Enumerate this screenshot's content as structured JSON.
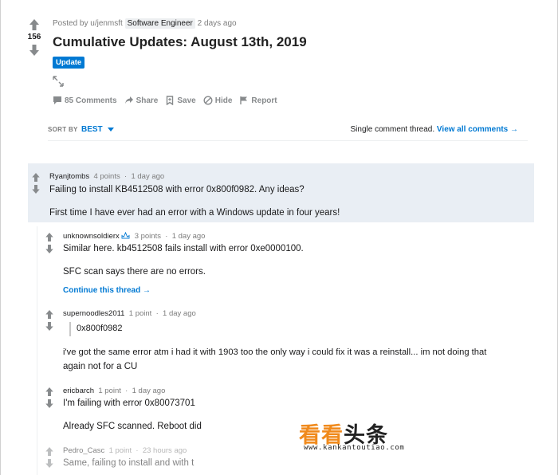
{
  "post": {
    "score": "156",
    "posted_by": "Posted by u/jenmsft",
    "flair": "Software Engineer",
    "age": "2 days ago",
    "title": "Cumulative Updates: August 13th, 2019",
    "tag": "Update",
    "actions": {
      "comments": "85 Comments",
      "share": "Share",
      "save": "Save",
      "hide": "Hide",
      "report": "Report"
    }
  },
  "sort": {
    "label": "SORT BY",
    "value": "BEST",
    "single_thread": "Single comment thread.",
    "view_all": "View all comments →"
  },
  "comments": [
    {
      "author": "Ryanjtombs",
      "points": "4 points",
      "sep": "·",
      "age": "1 day ago",
      "line1": "Failing to install KB4512508 with error 0x800f0982. Any ideas?",
      "line2": "First time I have ever had an error with a Windows update in four years!"
    },
    {
      "author": "unknownsoldierx",
      "points": "3 points",
      "sep": "·",
      "age": "1 day ago",
      "line1": "Similar here. kb4512508 fails install with error 0xe0000100.",
      "line2": "SFC scan says there are no errors.",
      "continue": "Continue this thread →"
    },
    {
      "author": "supernoodles2011",
      "points": "1 point",
      "sep": "·",
      "age": "1 day ago",
      "quote": "0x800f0982",
      "line1": "i've got the same error atm i had it with 1903 too the only way i could fix it was a reinstall... im not doing that",
      "line2": "again not for a CU"
    },
    {
      "author": "ericbarch",
      "points": "1 point",
      "sep": "·",
      "age": "1 day ago",
      "line1": "I'm failing with error 0x80073701",
      "line2": "Already SFC scanned. Reboot did"
    },
    {
      "author": "Pedro_Casc",
      "points": "1 point",
      "sep": "·",
      "age": "23 hours ago",
      "line1": "Same, failing to install and with t"
    }
  ],
  "watermark": {
    "cn_orange": "看看",
    "cn_dark": "头条",
    "url": "www.kankantoutiao.com"
  },
  "colors": {
    "accent": "#0079d3",
    "highlight": "#e9eef4",
    "watermark_orange": "#f08a1c"
  }
}
